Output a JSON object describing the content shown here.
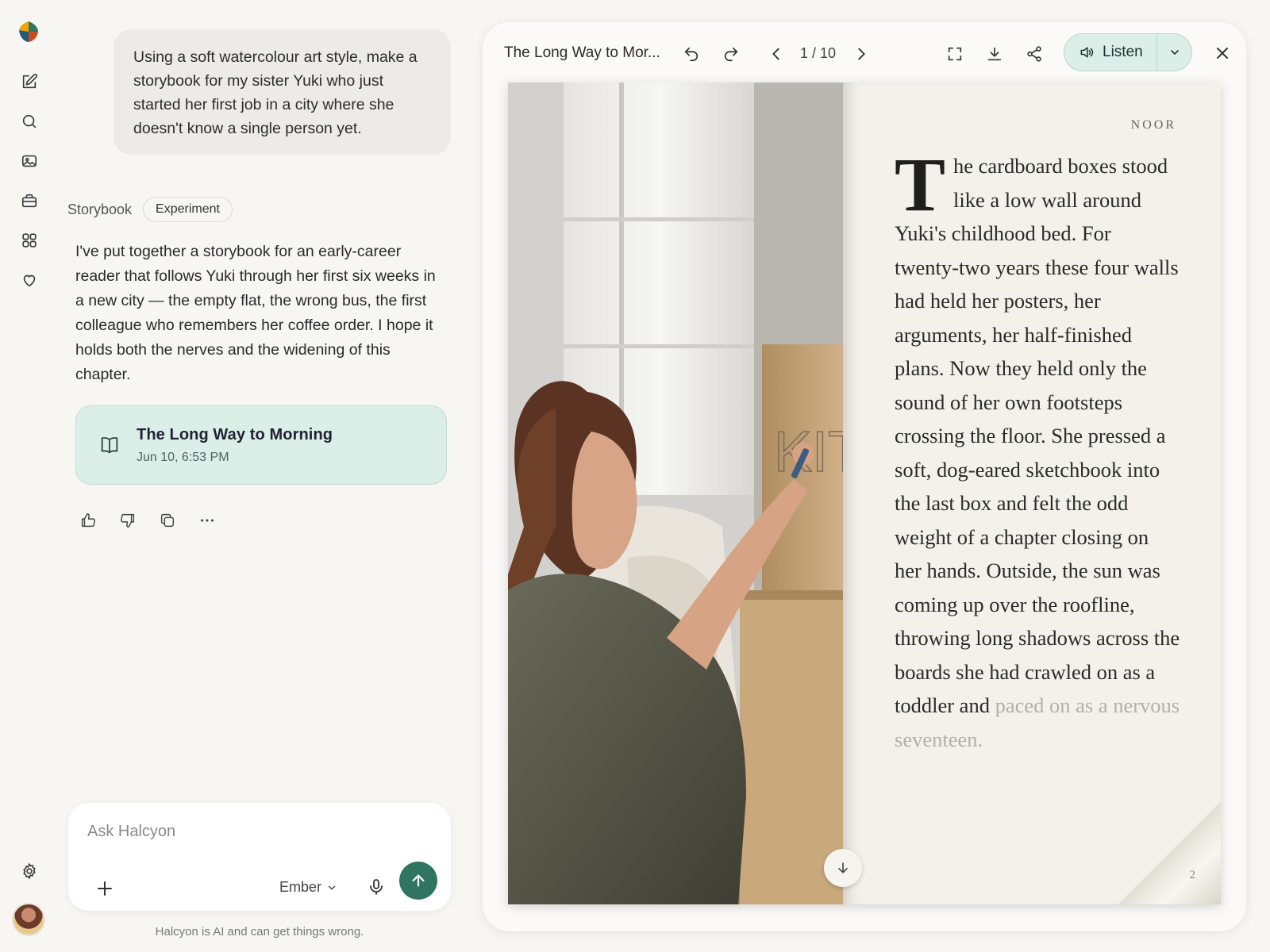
{
  "app": {
    "name": "Halcyon"
  },
  "chat": {
    "user_prompt": "Using a soft watercolour art style, make a storybook for my sister Yuki who just started her first job in a city where she doesn't know a single person yet.",
    "tag_label": "Storybook",
    "tag_pill": "Experiment",
    "response": "I've put together a storybook for an early-career reader that follows Yuki through her first six weeks in a new city — the empty flat, the wrong bus, the first colleague who remembers her coffee order. I hope it holds both the nerves and the widening of this chapter.",
    "card": {
      "title": "The Long Way to Morning",
      "date": "Jun 10, 6:53 PM"
    },
    "actions": [
      "thumbs-up-icon",
      "thumbs-down-icon",
      "copy-icon",
      "more-icon"
    ]
  },
  "composer": {
    "placeholder": "Ask Halcyon",
    "model": "Ember",
    "disclaimer": "Halcyon is AI and can get things wrong."
  },
  "viewer": {
    "title": "The Long Way to Mor...",
    "page_indicator": "1 / 10",
    "listen_label": "Listen",
    "author": "NOOR",
    "dropcap": "T",
    "story_text": "he cardboard boxes stood like a low wall around Yuki's childhood bed. For twenty-two years these four walls had held her posters, her arguments, her half-finished plans. Now they held only the sound of her own footsteps crossing the floor. She pressed a soft, dog-eared sketchbook into the last box and felt the odd weight of a chapter closing on her hands. Outside, the sun was coming up over the roofline, throwing long shadows across the boards she had crawled on as a toddler and ",
    "story_faded": "paced on as a nervous seventeen.",
    "page_number": "2",
    "box_text": "KIT"
  },
  "colors": {
    "accent": "#2f7560",
    "card_bg": "#dbeee8",
    "page_bg": "#f3f1ea"
  }
}
